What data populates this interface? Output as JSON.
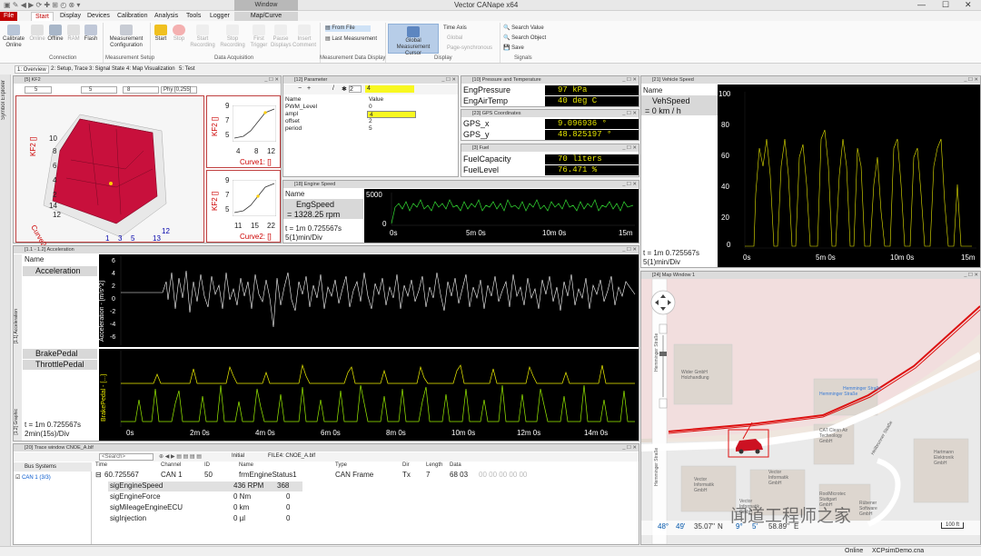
{
  "app": {
    "title": "Vector CANape x64",
    "window_tab": "Window"
  },
  "tabs": [
    {
      "label": "File"
    },
    {
      "label": "Start"
    },
    {
      "label": "Display"
    },
    {
      "label": "Devices"
    },
    {
      "label": "Calibration"
    },
    {
      "label": "Analysis"
    },
    {
      "label": "Tools"
    },
    {
      "label": "Logger"
    },
    {
      "label": "Map/Curve"
    }
  ],
  "ribbon": {
    "calibrate": "Calibrate Online",
    "online": "Online",
    "offline": "Offline",
    "ram": "RAM",
    "flash": "Flash",
    "meas_config": "Measurement Configuration",
    "start": "Start",
    "stop": "Stop",
    "start_rec": "Start Recording",
    "stop_rec": "Stop Recording",
    "first_trig": "First Trigger",
    "pause": "Pause Displays",
    "insert_comment": "Insert Comment",
    "from_file": "From File",
    "last_meas": "Last Measurement",
    "global_cursor": "Global Measurement Cursor",
    "time_axis": "Time Axis",
    "global": "Global",
    "page_sync": "Page-synchronous",
    "search_value": "Search Value",
    "search_object": "Search Object",
    "save": "Save",
    "groups": {
      "connection": "Connection",
      "meas_setup": "Measurement Setup",
      "data_acq": "Data Acquisition",
      "meas_disp": "Measurement Data Display",
      "display": "Display",
      "signals": "Signals"
    }
  },
  "doc_tabs": [
    "1: Overview",
    "2: Setup, Trace",
    "3: Signal State",
    "4: Map Visualization",
    "5: Test"
  ],
  "symbol_explorer": "Symbol Explorer",
  "kf2": {
    "title": "[5] KF2",
    "x1": "5",
    "x2": "5",
    "x3": "8",
    "phy": "Phy [0,255]",
    "zlabel": "KF2 []",
    "ylabel": "Curve2: []",
    "z_ticks": [
      "10",
      "8",
      "6",
      "4",
      "2",
      "14",
      "12"
    ],
    "x_ticks": [
      "12",
      "13",
      "5",
      "3",
      "1"
    ],
    "c1_y": [
      "9",
      "7",
      "5"
    ],
    "c1_x": [
      "4",
      "8",
      "12"
    ],
    "c1_lab": "Curve1: []",
    "c1_ylab": "KF2 []",
    "c2_y": [
      "9",
      "7",
      "5"
    ],
    "c2_x": [
      "11",
      "15",
      "22"
    ],
    "c2_lab": "Curve2: []",
    "c2_ylab": "KF2 []"
  },
  "param": {
    "title": "[12] Parameter",
    "input": "2",
    "value": "4",
    "cols": [
      "Name",
      "Value"
    ],
    "rows": [
      {
        "n": "PWM_Level",
        "v": "0"
      },
      {
        "n": "ampl",
        "v": "4"
      },
      {
        "n": "offset",
        "v": "2"
      },
      {
        "n": "period",
        "v": "5"
      }
    ]
  },
  "pt": {
    "title": "[10] Pressure and Temperature",
    "rows": [
      {
        "n": "EngPressure",
        "v": "97 kPa"
      },
      {
        "n": "EngAirTemp",
        "v": "40 deg C"
      }
    ]
  },
  "gps": {
    "title": "[23] GPS Coordinates",
    "rows": [
      {
        "n": "GPS_x",
        "v": "9.096936 °"
      },
      {
        "n": "GPS_y",
        "v": "48.825197 °"
      }
    ]
  },
  "fuel": {
    "title": "[3] Fuel",
    "rows": [
      {
        "n": "FuelCapacity",
        "v": "70 liters"
      },
      {
        "n": "FuelLevel",
        "v": "76.471 %"
      }
    ]
  },
  "veh": {
    "title": "[21] Vehicle Speed",
    "name_col": "Name",
    "signal": "VehSpeed",
    "value": "= 0 km / h",
    "t": "t = 1m 0.725567s",
    "div": "5(1)min/Div",
    "y_ticks": [
      "100",
      "80",
      "60",
      "40",
      "20",
      "0"
    ],
    "x_ticks": [
      "0s",
      "5m 0s",
      "10m 0s",
      "15m"
    ]
  },
  "eng": {
    "title": "[18] Engine Speed",
    "name_col": "Name",
    "signal": "EngSpeed",
    "value": "= 1328.25 rpm",
    "t": "t = 1m 0.725567s",
    "div": "5(1)min/Div",
    "y_ticks": [
      "5000",
      "0"
    ],
    "x_ticks": [
      "0s",
      "5m 0s",
      "10m 0s",
      "15m"
    ]
  },
  "acc": {
    "title": "[1.1 - 1.2] Acceleration",
    "name_col": "Name",
    "sig1": "Acceleration",
    "sig2": "BrakePedal",
    "sig3": "ThrottlePedal",
    "ylab1": "Acceleration - [m/s^2]",
    "ylab2": "BrakePedal - [...]",
    "y_ticks": [
      "6",
      "4",
      "2",
      "0",
      "-2",
      "-4",
      "-6"
    ],
    "x_ticks": [
      "0s",
      "2m 0s",
      "4m 0s",
      "6m 0s",
      "8m 0s",
      "10m 0s",
      "12m 0s",
      "14m 0s"
    ],
    "t": "t = 1m 0.725567s",
    "div": "2min(15s)/Div",
    "side1": "[1.1] Acceleration",
    "side2": "[1.2] Graphic"
  },
  "trace": {
    "title": "[20] Trace window CNOE_A.blf",
    "search": "<Search>",
    "initial": "Initial",
    "file": "FILE4: CNOE_A.blf",
    "bus_header": "Bus Systems",
    "bus": "CAN 1 (3/3)",
    "cols": [
      "Time",
      "Channel",
      "ID",
      "Name",
      "Type",
      "Dir",
      "Length",
      "Data"
    ],
    "msg": {
      "time": "60.725567",
      "ch": "CAN 1",
      "id": "50",
      "name": "frmEngineStatus1",
      "type": "CAN Frame",
      "dir": "Tx",
      "len": "7",
      "data_hi": "68 03",
      "data_lo": "00 00 00 00 00"
    },
    "sigs": [
      {
        "n": "sigEngineSpeed",
        "v": "436 RPM",
        "r": "368"
      },
      {
        "n": "sigEngineForce",
        "v": "0 Nm",
        "r": "0"
      },
      {
        "n": "sigMileageEngineECU",
        "v": "0 km",
        "r": "0"
      },
      {
        "n": "sigInjection",
        "v": "0 µl",
        "r": "0"
      }
    ]
  },
  "map": {
    "title": "[24] Map Window 1",
    "street1": "Hemminger Straße",
    "street2": "Hemminger Straße",
    "street3": "Heilbronner Straße",
    "poi": [
      "Wider GmbH Holzhandlung",
      "Hemminger Straße",
      "Hemminger Straße",
      "CAT Clean Air Technology GmbH",
      "Vector Informatik GmbH",
      "Vector Informatik GmbH",
      "Vector Informatik GmbH",
      "RoolMicrotec Stuttgart GmbH",
      "Rübener Software GmbH",
      "Hartmann Elektronik GmbH"
    ],
    "coord": {
      "a": "48°",
      "b": "49'",
      "c": "35.07''",
      "d": "N",
      "e": "9°",
      "f": "5'",
      "g": "58.89''",
      "h": "E"
    },
    "scale": "100 ft",
    "watermark": "闻道工程师之家"
  },
  "status": {
    "online": "Online",
    "file": "XCPsimDemo.cna"
  },
  "colors": {
    "accent": "#c00000",
    "map_route": "#dd1111",
    "curve_green": "#33dd33",
    "yellow": "#eeee00"
  }
}
